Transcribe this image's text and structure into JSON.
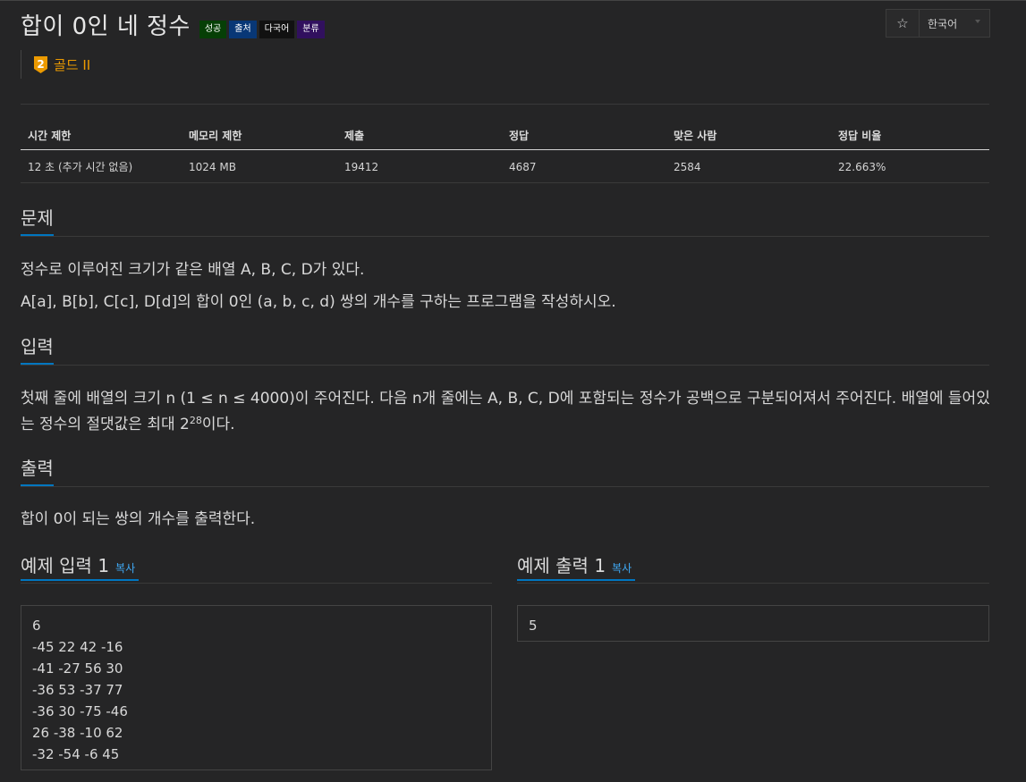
{
  "problem": {
    "title": "합이 0인 네 정수",
    "labels": [
      {
        "text": "성공",
        "color": "#063f06"
      },
      {
        "text": "출처",
        "color": "#083776"
      },
      {
        "text": "다국어",
        "color": "#111111"
      },
      {
        "text": "분류",
        "color": "#31105e"
      }
    ],
    "tier_number": "2",
    "tier_text": "골드 II",
    "tier_color": "#ec9a00"
  },
  "toolbar": {
    "star_icon": "☆",
    "language": "한국어"
  },
  "info_table": {
    "headers": [
      "시간 제한",
      "메모리 제한",
      "제출",
      "정답",
      "맞은 사람",
      "정답 비율"
    ],
    "row": [
      "12 초 (추가 시간 없음)",
      "1024 MB",
      "19412",
      "4687",
      "2584",
      "22.663%"
    ]
  },
  "sections": {
    "problem_heading": "문제",
    "problem_lines": [
      "정수로 이루어진 크기가 같은 배열 A, B, C, D가 있다.",
      "A[a], B[b], C[c], D[d]의 합이 0인 (a, b, c, d) 쌍의 개수를 구하는 프로그램을 작성하시오."
    ],
    "input_heading": "입력",
    "input_text_before": "첫째 줄에 배열의 크기 n (1 ≤ n ≤ 4000)이 주어진다. 다음 n개 줄에는 A, B, C, D에 포함되는 정수가 공백으로 구분되어져서 주어진다. 배열에 들어있는 정수의 절댓값은 최대 2",
    "input_sup": "28",
    "input_text_after": "이다.",
    "output_heading": "출력",
    "output_text": "합이 0이 되는 쌍의 개수를 출력한다."
  },
  "examples": {
    "input_heading": "예제 입력 1",
    "output_heading": "예제 출력 1",
    "copy_label": "복사",
    "input_lines": [
      "6",
      "-45 22 42 -16",
      "-41 -27 56 30",
      "-36 53 -37 77",
      "-36 30 -75 -46",
      "26 -38 -10 62",
      "-32 -54 -6 45"
    ],
    "output_lines": [
      "5"
    ]
  }
}
